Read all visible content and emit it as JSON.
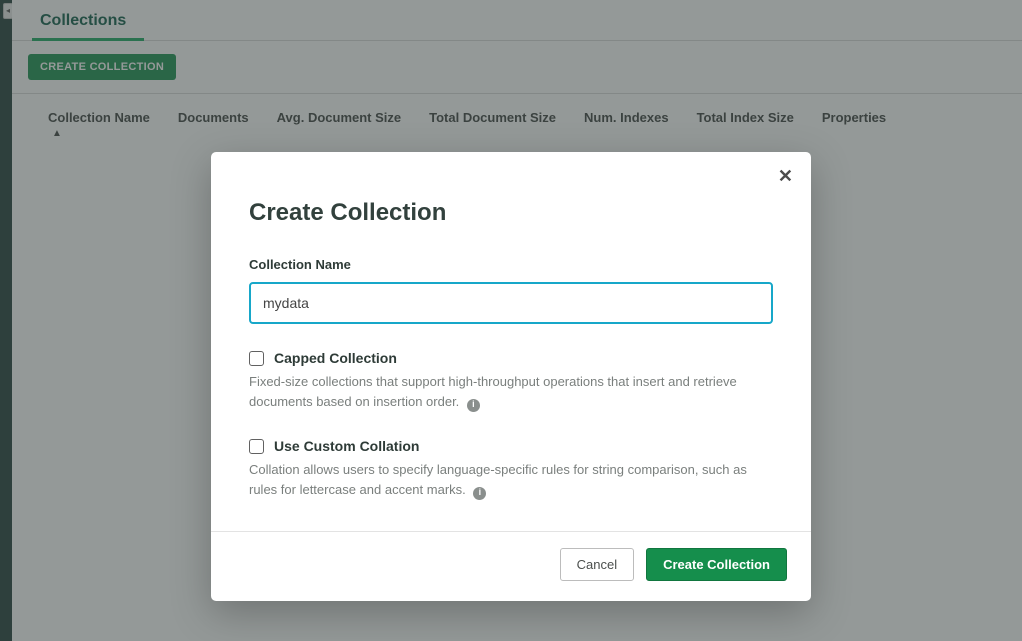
{
  "header": {
    "tab_label": "Collections",
    "create_button": "CREATE COLLECTION"
  },
  "columns": {
    "name": "Collection Name",
    "documents": "Documents",
    "avg_size": "Avg. Document Size",
    "total_doc_size": "Total Document Size",
    "num_indexes": "Num. Indexes",
    "total_index_size": "Total Index Size",
    "properties": "Properties"
  },
  "modal": {
    "title": "Create Collection",
    "name_label": "Collection Name",
    "name_value": "mydata",
    "capped": {
      "label": "Capped Collection",
      "help": "Fixed-size collections that support high-throughput operations that insert and retrieve documents based on insertion order."
    },
    "collation": {
      "label": "Use Custom Collation",
      "help": "Collation allows users to specify language-specific rules for string comparison, such as rules for lettercase and accent marks."
    },
    "cancel": "Cancel",
    "submit": "Create Collection",
    "close_glyph": "✕",
    "info_glyph": "i"
  }
}
